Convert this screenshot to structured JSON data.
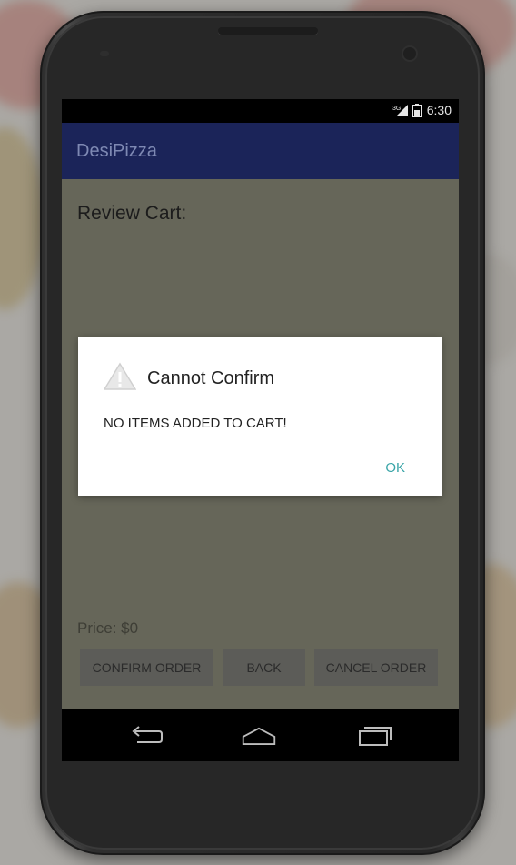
{
  "status_bar": {
    "network": "3G",
    "time": "6:30"
  },
  "app": {
    "title": "DesiPizza"
  },
  "screen": {
    "heading": "Review Cart:",
    "price": "Price: $0",
    "buttons": {
      "confirm": "CONFIRM ORDER",
      "back": "BACK",
      "cancel": "CANCEL ORDER"
    }
  },
  "dialog": {
    "icon": "warning-icon",
    "title": "Cannot Confirm",
    "message": "NO ITEMS ADDED TO CART!",
    "ok": "OK"
  },
  "nav": {
    "back_icon": "back-icon",
    "home_icon": "home-icon",
    "recents_icon": "recents-icon"
  },
  "colors": {
    "appbar": "#1b2459",
    "screen_bg_dimmed": "#666659",
    "dialog_button": "#3aa5a8"
  }
}
